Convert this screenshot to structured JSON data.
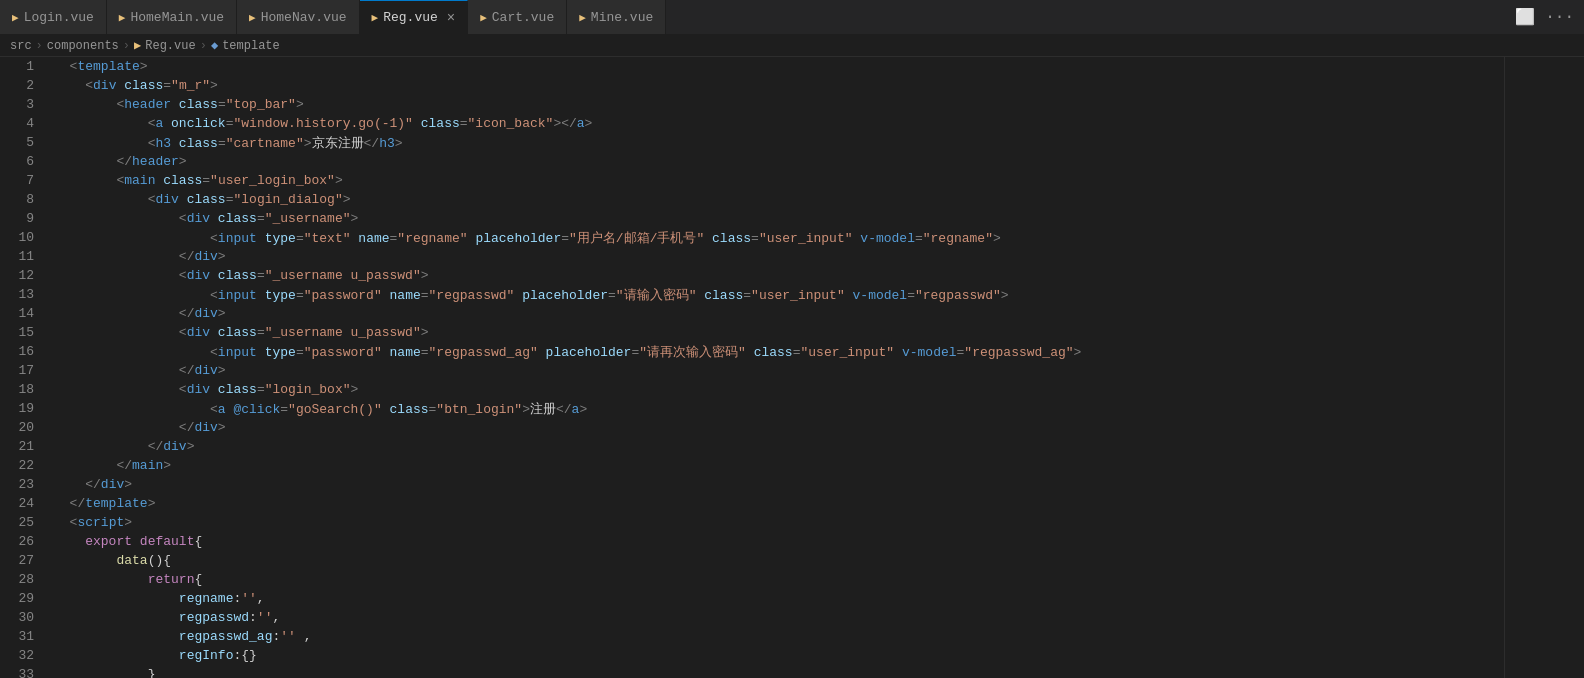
{
  "tabs": [
    {
      "id": "login",
      "label": "Login.vue",
      "icon": "▶",
      "active": false,
      "modified": false
    },
    {
      "id": "homemain",
      "label": "HomeMain.vue",
      "icon": "▶",
      "active": false,
      "modified": false
    },
    {
      "id": "homenav",
      "label": "HomeNav.vue",
      "icon": "▶",
      "active": false,
      "modified": false
    },
    {
      "id": "reg",
      "label": "Reg.vue",
      "icon": "▶",
      "active": true,
      "modified": true
    },
    {
      "id": "cart",
      "label": "Cart.vue",
      "icon": "▶",
      "active": false,
      "modified": false
    },
    {
      "id": "mine",
      "label": "Mine.vue",
      "icon": "▶",
      "active": false,
      "modified": false
    }
  ],
  "breadcrumb": {
    "parts": [
      "src",
      ">",
      "components",
      ">",
      "Reg.vue",
      ">",
      "template"
    ]
  },
  "lines": [
    {
      "num": 1,
      "tokens": [
        {
          "t": "  ",
          "c": ""
        },
        {
          "t": "<",
          "c": "punct"
        },
        {
          "t": "template",
          "c": "kw"
        },
        {
          "t": ">",
          "c": "punct"
        }
      ]
    },
    {
      "num": 2,
      "tokens": [
        {
          "t": "    ",
          "c": ""
        },
        {
          "t": "<",
          "c": "punct"
        },
        {
          "t": "div",
          "c": "kw"
        },
        {
          "t": " ",
          "c": ""
        },
        {
          "t": "class",
          "c": "attr"
        },
        {
          "t": "=",
          "c": "punct"
        },
        {
          "t": "\"m_r\"",
          "c": "str"
        },
        {
          "t": ">",
          "c": "punct"
        }
      ]
    },
    {
      "num": 3,
      "tokens": [
        {
          "t": "        ",
          "c": ""
        },
        {
          "t": "<",
          "c": "punct"
        },
        {
          "t": "header",
          "c": "kw"
        },
        {
          "t": " ",
          "c": ""
        },
        {
          "t": "class",
          "c": "attr"
        },
        {
          "t": "=",
          "c": "punct"
        },
        {
          "t": "\"top_bar\"",
          "c": "str"
        },
        {
          "t": ">",
          "c": "punct"
        }
      ]
    },
    {
      "num": 4,
      "tokens": [
        {
          "t": "            ",
          "c": ""
        },
        {
          "t": "<",
          "c": "punct"
        },
        {
          "t": "a",
          "c": "kw"
        },
        {
          "t": " ",
          "c": ""
        },
        {
          "t": "onclick",
          "c": "attr"
        },
        {
          "t": "=",
          "c": "punct"
        },
        {
          "t": "\"window.history.go(-1)\"",
          "c": "str"
        },
        {
          "t": " ",
          "c": ""
        },
        {
          "t": "class",
          "c": "attr"
        },
        {
          "t": "=",
          "c": "punct"
        },
        {
          "t": "\"icon_back\"",
          "c": "str"
        },
        {
          "t": "></",
          "c": "punct"
        },
        {
          "t": "a",
          "c": "kw"
        },
        {
          "t": ">",
          "c": "punct"
        }
      ]
    },
    {
      "num": 5,
      "tokens": [
        {
          "t": "            ",
          "c": ""
        },
        {
          "t": "<",
          "c": "punct"
        },
        {
          "t": "h3",
          "c": "kw"
        },
        {
          "t": " ",
          "c": ""
        },
        {
          "t": "class",
          "c": "attr"
        },
        {
          "t": "=",
          "c": "punct"
        },
        {
          "t": "\"cartname\"",
          "c": "str"
        },
        {
          "t": ">",
          "c": "punct"
        },
        {
          "t": "京东注册",
          "c": "text-content"
        },
        {
          "t": "</",
          "c": "punct"
        },
        {
          "t": "h3",
          "c": "kw"
        },
        {
          "t": ">",
          "c": "punct"
        }
      ]
    },
    {
      "num": 6,
      "tokens": [
        {
          "t": "        ",
          "c": ""
        },
        {
          "t": "</",
          "c": "punct"
        },
        {
          "t": "header",
          "c": "kw"
        },
        {
          "t": ">",
          "c": "punct"
        }
      ]
    },
    {
      "num": 7,
      "tokens": [
        {
          "t": "        ",
          "c": ""
        },
        {
          "t": "<",
          "c": "punct"
        },
        {
          "t": "main",
          "c": "kw"
        },
        {
          "t": " ",
          "c": ""
        },
        {
          "t": "class",
          "c": "attr"
        },
        {
          "t": "=",
          "c": "punct"
        },
        {
          "t": "\"user_login_box\"",
          "c": "str"
        },
        {
          "t": ">",
          "c": "punct"
        }
      ]
    },
    {
      "num": 8,
      "tokens": [
        {
          "t": "            ",
          "c": ""
        },
        {
          "t": "<",
          "c": "punct"
        },
        {
          "t": "div",
          "c": "kw"
        },
        {
          "t": " ",
          "c": ""
        },
        {
          "t": "class",
          "c": "attr"
        },
        {
          "t": "=",
          "c": "punct"
        },
        {
          "t": "\"login_dialog\"",
          "c": "str"
        },
        {
          "t": ">",
          "c": "punct"
        }
      ]
    },
    {
      "num": 9,
      "tokens": [
        {
          "t": "                ",
          "c": ""
        },
        {
          "t": "<",
          "c": "punct"
        },
        {
          "t": "div",
          "c": "kw"
        },
        {
          "t": " ",
          "c": ""
        },
        {
          "t": "class",
          "c": "attr"
        },
        {
          "t": "=",
          "c": "punct"
        },
        {
          "t": "\"_username\"",
          "c": "str"
        },
        {
          "t": ">",
          "c": "punct"
        }
      ]
    },
    {
      "num": 10,
      "tokens": [
        {
          "t": "                    ",
          "c": ""
        },
        {
          "t": "<",
          "c": "punct"
        },
        {
          "t": "input",
          "c": "kw"
        },
        {
          "t": " ",
          "c": ""
        },
        {
          "t": "type",
          "c": "attr"
        },
        {
          "t": "=",
          "c": "punct"
        },
        {
          "t": "\"text\"",
          "c": "str"
        },
        {
          "t": " ",
          "c": ""
        },
        {
          "t": "name",
          "c": "attr"
        },
        {
          "t": "=",
          "c": "punct"
        },
        {
          "t": "\"regname\"",
          "c": "str"
        },
        {
          "t": " ",
          "c": ""
        },
        {
          "t": "placeholder",
          "c": "attr"
        },
        {
          "t": "=",
          "c": "punct"
        },
        {
          "t": "\"用户名/邮箱/手机号\"",
          "c": "str"
        },
        {
          "t": " ",
          "c": ""
        },
        {
          "t": "class",
          "c": "attr"
        },
        {
          "t": "=",
          "c": "punct"
        },
        {
          "t": "\"user_input\"",
          "c": "str"
        },
        {
          "t": " ",
          "c": ""
        },
        {
          "t": "v-model",
          "c": "vue-dir"
        },
        {
          "t": "=",
          "c": "punct"
        },
        {
          "t": "\"regname\"",
          "c": "str"
        },
        {
          "t": ">",
          "c": "punct"
        }
      ]
    },
    {
      "num": 11,
      "tokens": [
        {
          "t": "                ",
          "c": ""
        },
        {
          "t": "</",
          "c": "punct"
        },
        {
          "t": "div",
          "c": "kw"
        },
        {
          "t": ">",
          "c": "punct"
        }
      ]
    },
    {
      "num": 12,
      "tokens": [
        {
          "t": "                ",
          "c": ""
        },
        {
          "t": "<",
          "c": "punct"
        },
        {
          "t": "div",
          "c": "kw"
        },
        {
          "t": " ",
          "c": ""
        },
        {
          "t": "class",
          "c": "attr"
        },
        {
          "t": "=",
          "c": "punct"
        },
        {
          "t": "\"_username u_passwd\"",
          "c": "str"
        },
        {
          "t": ">",
          "c": "punct"
        }
      ]
    },
    {
      "num": 13,
      "tokens": [
        {
          "t": "                    ",
          "c": ""
        },
        {
          "t": "<",
          "c": "punct"
        },
        {
          "t": "input",
          "c": "kw"
        },
        {
          "t": " ",
          "c": ""
        },
        {
          "t": "type",
          "c": "attr"
        },
        {
          "t": "=",
          "c": "punct"
        },
        {
          "t": "\"password\"",
          "c": "str"
        },
        {
          "t": " ",
          "c": ""
        },
        {
          "t": "name",
          "c": "attr"
        },
        {
          "t": "=",
          "c": "punct"
        },
        {
          "t": "\"regpasswd\"",
          "c": "str"
        },
        {
          "t": " ",
          "c": ""
        },
        {
          "t": "placeholder",
          "c": "attr"
        },
        {
          "t": "=",
          "c": "punct"
        },
        {
          "t": "\"请输入密码\"",
          "c": "str"
        },
        {
          "t": " ",
          "c": ""
        },
        {
          "t": "class",
          "c": "attr"
        },
        {
          "t": "=",
          "c": "punct"
        },
        {
          "t": "\"user_input\"",
          "c": "str"
        },
        {
          "t": " ",
          "c": ""
        },
        {
          "t": "v-model",
          "c": "vue-dir"
        },
        {
          "t": "=",
          "c": "punct"
        },
        {
          "t": "\"regpasswd\"",
          "c": "str"
        },
        {
          "t": ">",
          "c": "punct"
        }
      ]
    },
    {
      "num": 14,
      "tokens": [
        {
          "t": "                ",
          "c": ""
        },
        {
          "t": "</",
          "c": "punct"
        },
        {
          "t": "div",
          "c": "kw"
        },
        {
          "t": ">",
          "c": "punct"
        }
      ]
    },
    {
      "num": 15,
      "tokens": [
        {
          "t": "                ",
          "c": ""
        },
        {
          "t": "<",
          "c": "punct"
        },
        {
          "t": "div",
          "c": "kw"
        },
        {
          "t": " ",
          "c": ""
        },
        {
          "t": "class",
          "c": "attr"
        },
        {
          "t": "=",
          "c": "punct"
        },
        {
          "t": "\"_username u_passwd\"",
          "c": "str"
        },
        {
          "t": ">",
          "c": "punct"
        }
      ]
    },
    {
      "num": 16,
      "tokens": [
        {
          "t": "                    ",
          "c": ""
        },
        {
          "t": "<",
          "c": "punct"
        },
        {
          "t": "input",
          "c": "kw"
        },
        {
          "t": " ",
          "c": ""
        },
        {
          "t": "type",
          "c": "attr"
        },
        {
          "t": "=",
          "c": "punct"
        },
        {
          "t": "\"password\"",
          "c": "str"
        },
        {
          "t": " ",
          "c": ""
        },
        {
          "t": "name",
          "c": "attr"
        },
        {
          "t": "=",
          "c": "punct"
        },
        {
          "t": "\"regpasswd_ag\"",
          "c": "str"
        },
        {
          "t": " ",
          "c": ""
        },
        {
          "t": "placeholder",
          "c": "attr"
        },
        {
          "t": "=",
          "c": "punct"
        },
        {
          "t": "\"请再次输入密码\"",
          "c": "str"
        },
        {
          "t": " ",
          "c": ""
        },
        {
          "t": "class",
          "c": "attr"
        },
        {
          "t": "=",
          "c": "punct"
        },
        {
          "t": "\"user_input\"",
          "c": "str"
        },
        {
          "t": " ",
          "c": ""
        },
        {
          "t": "v-model",
          "c": "vue-dir"
        },
        {
          "t": "=",
          "c": "punct"
        },
        {
          "t": "\"regpasswd_ag\"",
          "c": "str"
        },
        {
          "t": ">",
          "c": "punct"
        }
      ]
    },
    {
      "num": 17,
      "tokens": [
        {
          "t": "                ",
          "c": ""
        },
        {
          "t": "</",
          "c": "punct"
        },
        {
          "t": "div",
          "c": "kw"
        },
        {
          "t": ">",
          "c": "punct"
        }
      ]
    },
    {
      "num": 18,
      "tokens": [
        {
          "t": "                ",
          "c": ""
        },
        {
          "t": "<",
          "c": "punct"
        },
        {
          "t": "div",
          "c": "kw"
        },
        {
          "t": " ",
          "c": ""
        },
        {
          "t": "class",
          "c": "attr"
        },
        {
          "t": "=",
          "c": "punct"
        },
        {
          "t": "\"login_box\"",
          "c": "str"
        },
        {
          "t": ">",
          "c": "punct"
        }
      ]
    },
    {
      "num": 19,
      "tokens": [
        {
          "t": "                    ",
          "c": ""
        },
        {
          "t": "<",
          "c": "punct"
        },
        {
          "t": "a",
          "c": "kw"
        },
        {
          "t": " ",
          "c": ""
        },
        {
          "t": "@click",
          "c": "vue-dir"
        },
        {
          "t": "=",
          "c": "punct"
        },
        {
          "t": "\"goSearch()\"",
          "c": "str"
        },
        {
          "t": " ",
          "c": ""
        },
        {
          "t": "class",
          "c": "attr"
        },
        {
          "t": "=",
          "c": "punct"
        },
        {
          "t": "\"btn_login\"",
          "c": "str"
        },
        {
          "t": ">",
          "c": "punct"
        },
        {
          "t": "注册",
          "c": "text-content"
        },
        {
          "t": "</",
          "c": "punct"
        },
        {
          "t": "a",
          "c": "kw"
        },
        {
          "t": ">",
          "c": "punct"
        }
      ]
    },
    {
      "num": 20,
      "tokens": [
        {
          "t": "                ",
          "c": ""
        },
        {
          "t": "</",
          "c": "punct"
        },
        {
          "t": "div",
          "c": "kw"
        },
        {
          "t": ">",
          "c": "punct"
        }
      ]
    },
    {
      "num": 21,
      "tokens": [
        {
          "t": "            ",
          "c": ""
        },
        {
          "t": "</",
          "c": "punct"
        },
        {
          "t": "div",
          "c": "kw"
        },
        {
          "t": ">",
          "c": "punct"
        }
      ]
    },
    {
      "num": 22,
      "tokens": [
        {
          "t": "        ",
          "c": ""
        },
        {
          "t": "</",
          "c": "punct"
        },
        {
          "t": "main",
          "c": "kw"
        },
        {
          "t": ">",
          "c": "punct"
        }
      ]
    },
    {
      "num": 23,
      "tokens": [
        {
          "t": "    ",
          "c": ""
        },
        {
          "t": "</",
          "c": "punct"
        },
        {
          "t": "div",
          "c": "kw"
        },
        {
          "t": ">",
          "c": "punct"
        }
      ]
    },
    {
      "num": 24,
      "tokens": [
        {
          "t": "  ",
          "c": ""
        },
        {
          "t": "</",
          "c": "punct"
        },
        {
          "t": "template",
          "c": "kw"
        },
        {
          "t": ">",
          "c": "punct"
        }
      ]
    },
    {
      "num": 25,
      "tokens": [
        {
          "t": "  ",
          "c": ""
        },
        {
          "t": "<",
          "c": "punct"
        },
        {
          "t": "script",
          "c": "kw"
        },
        {
          "t": ">",
          "c": "punct"
        }
      ]
    },
    {
      "num": 26,
      "tokens": [
        {
          "t": "    ",
          "c": ""
        },
        {
          "t": "export",
          "c": "js-kw"
        },
        {
          "t": " ",
          "c": ""
        },
        {
          "t": "default",
          "c": "js-kw"
        },
        {
          "t": "{",
          "c": "js-punct"
        }
      ]
    },
    {
      "num": 27,
      "tokens": [
        {
          "t": "        ",
          "c": ""
        },
        {
          "t": "data",
          "c": "js-fn"
        },
        {
          "t": "()",
          "c": "js-punct"
        },
        {
          "t": "{",
          "c": "js-punct"
        }
      ]
    },
    {
      "num": 28,
      "tokens": [
        {
          "t": "            ",
          "c": ""
        },
        {
          "t": "return",
          "c": "js-kw"
        },
        {
          "t": "{",
          "c": "js-punct"
        }
      ]
    },
    {
      "num": 29,
      "tokens": [
        {
          "t": "                ",
          "c": ""
        },
        {
          "t": "regname",
          "c": "js-var"
        },
        {
          "t": ":",
          "c": "js-punct"
        },
        {
          "t": "''",
          "c": "js-str"
        },
        {
          "t": ",",
          "c": "js-punct"
        }
      ]
    },
    {
      "num": 30,
      "tokens": [
        {
          "t": "                ",
          "c": ""
        },
        {
          "t": "regpasswd",
          "c": "js-var"
        },
        {
          "t": ":",
          "c": "js-punct"
        },
        {
          "t": "''",
          "c": "js-str"
        },
        {
          "t": ",",
          "c": "js-punct"
        }
      ]
    },
    {
      "num": 31,
      "tokens": [
        {
          "t": "                ",
          "c": ""
        },
        {
          "t": "regpasswd_ag",
          "c": "js-var"
        },
        {
          "t": ":",
          "c": "js-punct"
        },
        {
          "t": "''",
          "c": "js-str"
        },
        {
          "t": " ,",
          "c": "js-punct"
        }
      ]
    },
    {
      "num": 32,
      "tokens": [
        {
          "t": "                ",
          "c": ""
        },
        {
          "t": "regInfo",
          "c": "js-var"
        },
        {
          "t": ":",
          "c": "js-punct"
        },
        {
          "t": "{}",
          "c": "js-punct"
        }
      ]
    },
    {
      "num": 33,
      "tokens": [
        {
          "t": "            ",
          "c": ""
        },
        {
          "t": "}",
          "c": "js-punct"
        }
      ]
    }
  ]
}
